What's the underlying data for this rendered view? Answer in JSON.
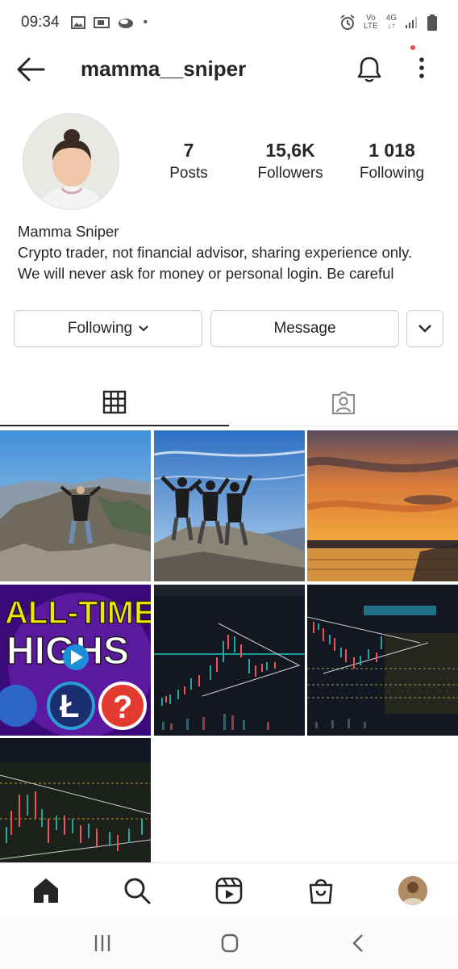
{
  "status_bar": {
    "time": "09:34",
    "left_icons": [
      "gallery-icon",
      "screen-share-icon",
      "cloud-icon"
    ],
    "dot": "•",
    "right_icons": [
      "alarm-icon",
      "volte-icon",
      "network-4g-icon",
      "signal-icon",
      "battery-icon"
    ],
    "volte_text_top": "Vo",
    "volte_text_bottom": "LTE",
    "network_label": "4G"
  },
  "header": {
    "username": "mamma__sniper",
    "back_icon": "back-arrow-icon",
    "bell_icon": "bell-icon",
    "more_icon": "more-vertical-icon"
  },
  "profile": {
    "stats": [
      {
        "value": "7",
        "label": "Posts"
      },
      {
        "value": "15,6K",
        "label": "Followers"
      },
      {
        "value": "1 018",
        "label": "Following"
      }
    ],
    "name": "Mamma Sniper",
    "bio_line1": "Crypto trader, not financial advisor, sharing experience only.",
    "bio_line2": "We will never ask for money or personal login. Be careful"
  },
  "actions": {
    "following_label": "Following",
    "message_label": "Message"
  },
  "tabs": [
    {
      "name": "posts-grid",
      "icon": "grid-icon",
      "active": true
    },
    {
      "name": "tagged",
      "icon": "tagged-person-icon",
      "active": false
    }
  ],
  "posts": {
    "thumb_text": {
      "alltime": "ALL-TIME",
      "highs": "HIGHS"
    }
  },
  "bottom_nav": [
    "home-icon",
    "search-icon",
    "reels-icon",
    "shop-icon",
    "profile-avatar"
  ],
  "colors": {
    "accent_red": "#ed4956",
    "text": "#262626",
    "border": "#cfcfcf",
    "chart_bg": "#131722",
    "thumbnail_yellow": "#f3e600",
    "thumbnail_purple": "#3a0a7a"
  }
}
